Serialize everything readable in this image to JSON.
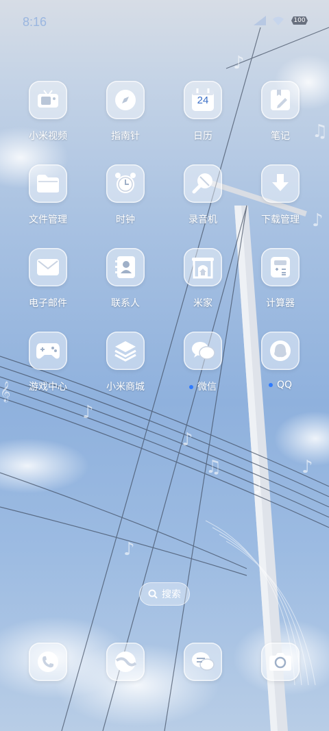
{
  "status_bar": {
    "time": "8:16",
    "battery": "100"
  },
  "apps": [
    {
      "label": "小米视频",
      "icon": "tv-icon",
      "dot": false
    },
    {
      "label": "指南针",
      "icon": "compass-icon",
      "dot": false
    },
    {
      "label": "日历",
      "icon": "calendar-icon",
      "dot": false,
      "date": "24"
    },
    {
      "label": "笔记",
      "icon": "notes-icon",
      "dot": false
    },
    {
      "label": "文件管理",
      "icon": "folder-icon",
      "dot": false
    },
    {
      "label": "时钟",
      "icon": "clock-icon",
      "dot": false
    },
    {
      "label": "录音机",
      "icon": "recorder-icon",
      "dot": false
    },
    {
      "label": "下载管理",
      "icon": "download-icon",
      "dot": false
    },
    {
      "label": "电子邮件",
      "icon": "mail-icon",
      "dot": false
    },
    {
      "label": "联系人",
      "icon": "contacts-icon",
      "dot": false
    },
    {
      "label": "米家",
      "icon": "home-icon",
      "dot": false
    },
    {
      "label": "计算器",
      "icon": "calculator-icon",
      "dot": false
    },
    {
      "label": "游戏中心",
      "icon": "gamepad-icon",
      "dot": false
    },
    {
      "label": "小米商城",
      "icon": "layers-icon",
      "dot": false
    },
    {
      "label": "微信",
      "icon": "wechat-icon",
      "dot": true
    },
    {
      "label": "QQ",
      "icon": "qq-icon",
      "dot": true
    }
  ],
  "search": {
    "label": "搜索"
  },
  "dock": [
    {
      "icon": "phone-icon"
    },
    {
      "icon": "browser-icon"
    },
    {
      "icon": "messages-icon"
    },
    {
      "icon": "camera-icon"
    }
  ]
}
